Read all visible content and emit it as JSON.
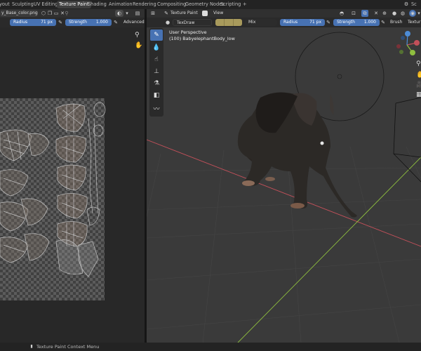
{
  "workspace_tabs": [
    {
      "label": "yout",
      "active": false
    },
    {
      "label": "Sculpting",
      "active": false
    },
    {
      "label": "UV Editing",
      "active": false
    },
    {
      "label": "Texture Paint",
      "active": true
    },
    {
      "label": "Shading",
      "active": false
    },
    {
      "label": "Animation",
      "active": false
    },
    {
      "label": "Rendering",
      "active": false
    },
    {
      "label": "Compositing",
      "active": false
    },
    {
      "label": "Geometry Nodes",
      "active": false
    },
    {
      "label": "Scripting",
      "active": false
    }
  ],
  "add_workspace": "+",
  "right_top_label": "Sc",
  "image_editor": {
    "image_name": "y_Base_color.png",
    "view_label": "View",
    "radius_label": "Radius",
    "radius_value": "71 px",
    "strength_label": "Strength",
    "strength_value": "1.000",
    "advanced_label": "Advanced"
  },
  "viewport_header": {
    "mode_label": "Texture Paint",
    "view_label": "View",
    "brush_name": "TexDraw",
    "blend_mode": "Mix",
    "radius_label": "Radius",
    "radius_value": "71 px",
    "strength_label": "Strength",
    "strength_value": "1.000",
    "brush_label": "Brush",
    "texture_label": "Textur",
    "brush_color": "#a89a5c"
  },
  "viewport": {
    "perspective_label": "User Perspective",
    "object_label": "(100) BabyelephantBody_low"
  },
  "status_bar": {
    "context_menu": "Texture Paint Context Menu"
  },
  "colors": {
    "accent": "#4772b3",
    "x_axis": "#c3505a",
    "y_axis": "#8fbf3f",
    "z_axis": "#4d8cd6"
  }
}
